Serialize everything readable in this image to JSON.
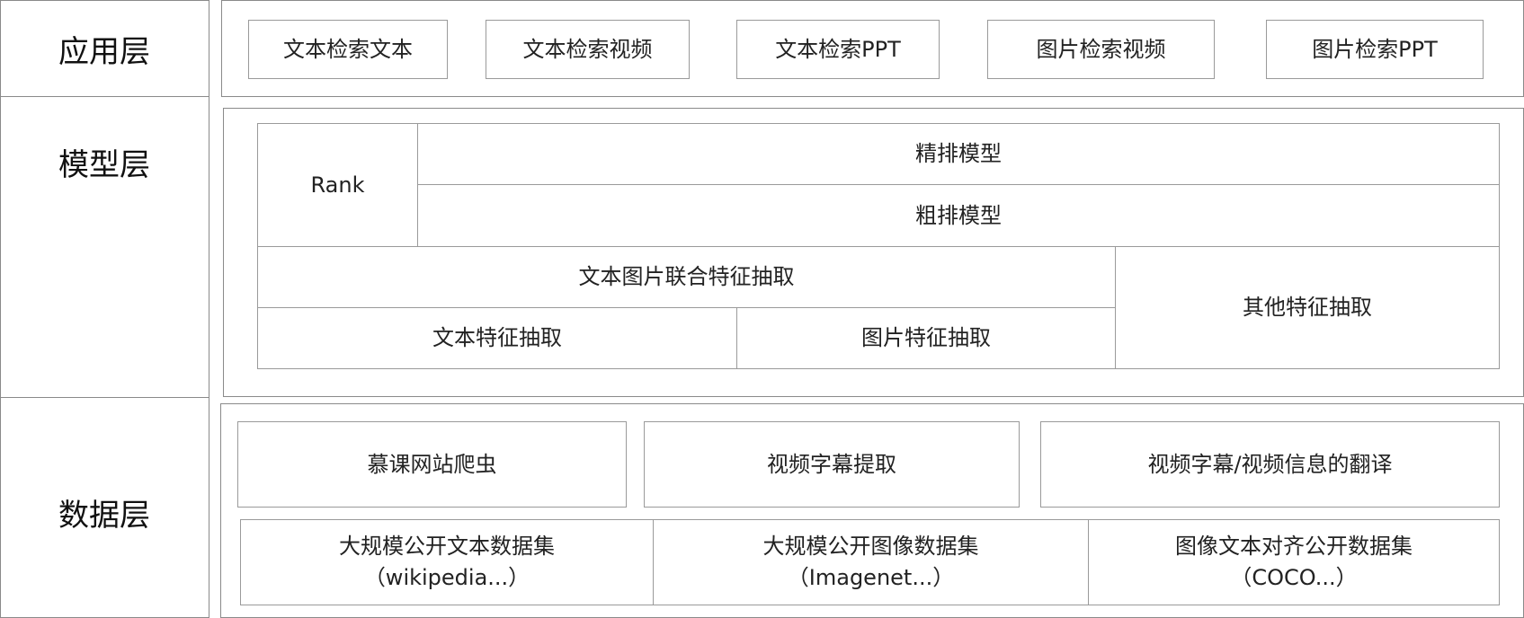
{
  "layers": {
    "application": {
      "label": "应用层"
    },
    "model": {
      "label": "模型层"
    },
    "data": {
      "label": "数据层"
    }
  },
  "application": {
    "items": [
      "文本检索文本",
      "文本检索视频",
      "文本检索PPT",
      "图片检索视频",
      "图片检索PPT"
    ]
  },
  "model": {
    "rank_label": "Rank",
    "fine_rank": "精排模型",
    "coarse_rank": "粗排模型",
    "joint_feature": "文本图片联合特征抽取",
    "text_feature": "文本特征抽取",
    "image_feature": "图片特征抽取",
    "other_feature": "其他特征抽取"
  },
  "data": {
    "crawler": "慕课网站爬虫",
    "subtitle_extract": "视频字幕提取",
    "translation": "视频字幕/视频信息的翻译",
    "datasets": [
      {
        "title": "大规模公开文本数据集",
        "sub": "（wikipedia...）"
      },
      {
        "title": "大规模公开图像数据集",
        "sub": "（Imagenet...）"
      },
      {
        "title": "图像文本对齐公开数据集",
        "sub": "（COCO...）"
      }
    ]
  }
}
